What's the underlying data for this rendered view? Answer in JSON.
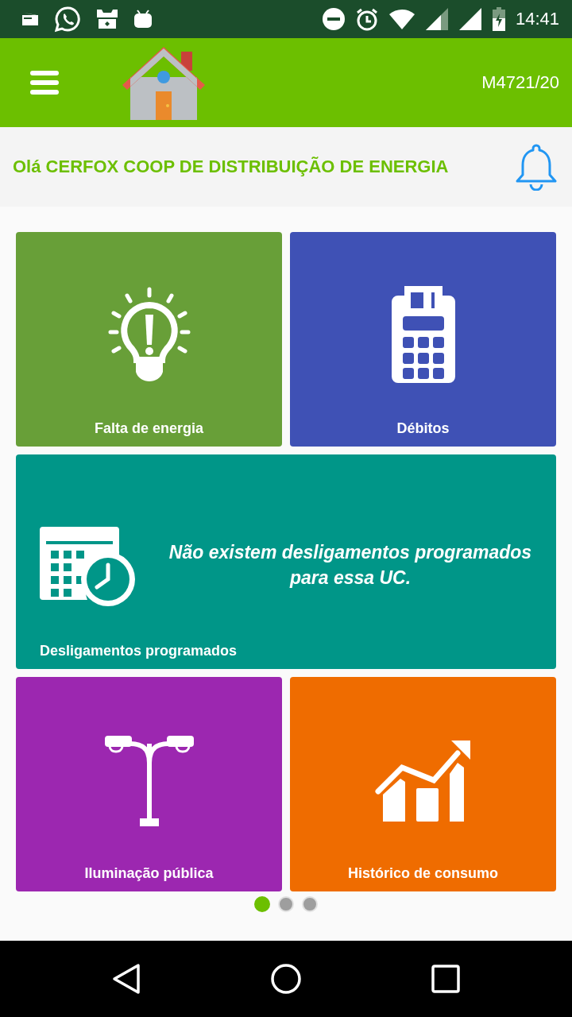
{
  "status_bar": {
    "time": "14:41"
  },
  "app_bar": {
    "account": "M4721/20"
  },
  "greeting": {
    "text": "Olá CERFOX COOP DE DISTRIBUIÇÃO DE ENERGIA"
  },
  "tiles": [
    {
      "kind": "outage",
      "label": "Falta de energia",
      "color": "#689f38"
    },
    {
      "kind": "debts",
      "label": "Débitos",
      "color": "#3f51b5"
    },
    {
      "kind": "schedule",
      "label": "Desligamentos programados",
      "color": "#009688",
      "message": "Não existem desligamentos programados para essa UC."
    },
    {
      "kind": "lighting",
      "label": "Iluminação pública",
      "color": "#9c27b0"
    },
    {
      "kind": "history",
      "label": "Histórico de consumo",
      "color": "#ef6c00"
    }
  ],
  "pager": [
    {
      "selected": true
    },
    {
      "selected": false
    },
    {
      "selected": false
    }
  ]
}
